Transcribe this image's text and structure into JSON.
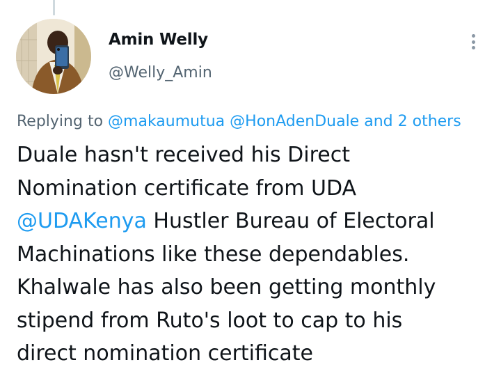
{
  "author": {
    "name": "Amin Welly",
    "handle": "@Welly_Amin"
  },
  "reply": {
    "prefix": "Replying to",
    "mentions": [
      "@makaumutua",
      "@HonAdenDuale"
    ],
    "others": "and 2 others"
  },
  "tweet": {
    "line1": "Duale hasn't received his Direct",
    "line2": "Nomination certificate from UDA",
    "mention": "@UDAKenya",
    "line3_rest": "Hustler Bureau of Electoral",
    "line4": "Machinations like these dependables.",
    "line5": "Khalwale has also been getting monthly",
    "line6": "stipend from Ruto's loot to cap to his",
    "line7": "direct nomination certificate"
  },
  "icons": {
    "more": "more-vertical-icon"
  },
  "colors": {
    "link": "#1d9bf0",
    "secondary_text": "#536471",
    "primary_text": "#0f1419",
    "background": "#ffffff"
  }
}
